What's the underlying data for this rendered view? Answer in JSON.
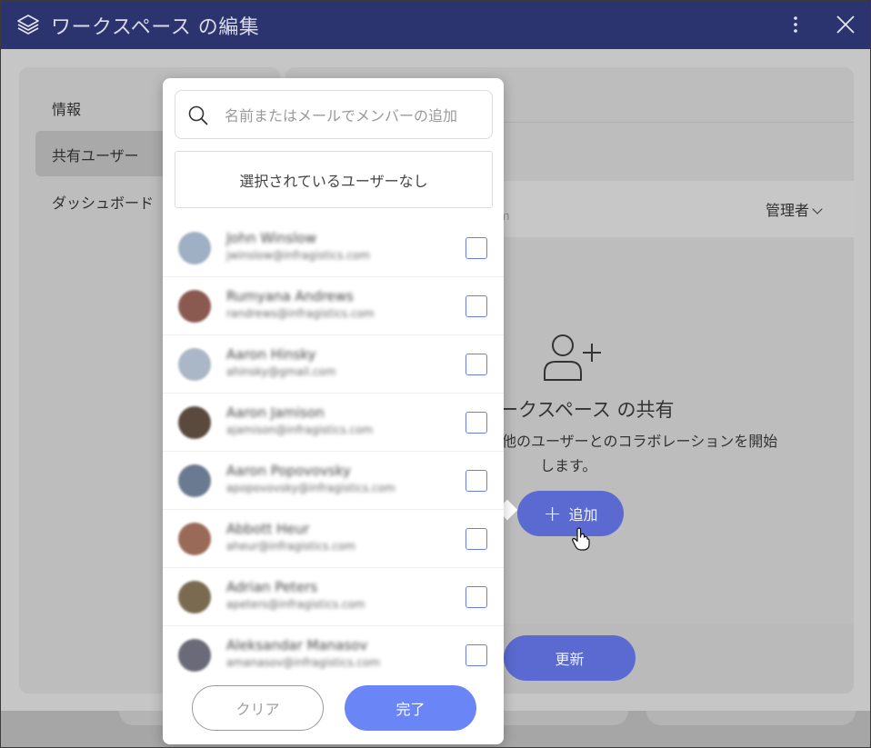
{
  "window": {
    "title": "ワークスペース の編集"
  },
  "sidebar": {
    "items": [
      {
        "label": "情報"
      },
      {
        "label": "共有ユーザー"
      },
      {
        "label": "ダッシュボード"
      }
    ]
  },
  "main": {
    "role_dropdown": "管理者",
    "faded_email": "m",
    "empty_state": {
      "icon": "add-user-icon",
      "title": "ークスペース の共有",
      "desc_line1": "他のユーザーとのコラボレーションを開始",
      "desc_line2": "します。",
      "add_label": "追加",
      "add_plus": "+"
    },
    "update_label": "更新"
  },
  "popover": {
    "search_placeholder": "名前またはメールでメンバーの追加",
    "selected_text": "選択されているユーザーなし",
    "users": [
      {
        "name": "John Winslow",
        "email": "jwinslow@infragistics.com",
        "avatar_color": "#9fb0c4",
        "checked": false
      },
      {
        "name": "Rumyana Andrews",
        "email": "randrews@infragistics.com",
        "avatar_color": "#8a5a50",
        "checked": false
      },
      {
        "name": "Aaron Hinsky",
        "email": "ahinsky@gmail.com",
        "avatar_color": "#a9b7c6",
        "checked": false
      },
      {
        "name": "Aaron Jamison",
        "email": "ajamison@infragistics.com",
        "avatar_color": "#5a4a3e",
        "checked": false
      },
      {
        "name": "Aaron Popovovsky",
        "email": "apopovovsky@infragistics.com",
        "avatar_color": "#6a7a90",
        "checked": false
      },
      {
        "name": "Abbott Heur",
        "email": "aheur@infragistics.com",
        "avatar_color": "#9a6a58",
        "checked": false
      },
      {
        "name": "Adrian Peters",
        "email": "apeters@infragistics.com",
        "avatar_color": "#7a6a50",
        "checked": false
      },
      {
        "name": "Aleksandar Manasov",
        "email": "amanasov@infragistics.com",
        "avatar_color": "#6a6a78",
        "checked": false
      }
    ],
    "clear_label": "クリア",
    "done_label": "完了"
  },
  "colors": {
    "titlebar": "#2c3470",
    "primary_button": "#5a6ad0",
    "done_button": "#6a86f6",
    "checkbox_border": "#6a7ee8"
  }
}
